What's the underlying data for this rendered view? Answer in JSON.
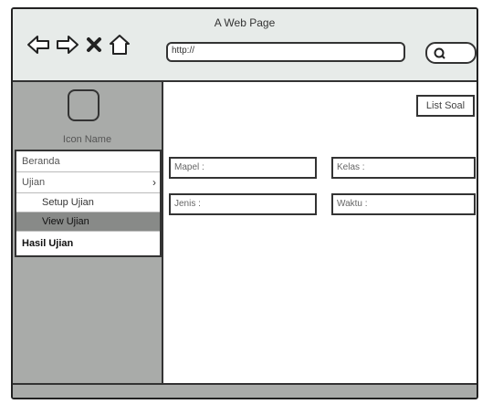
{
  "window": {
    "title": "A Web Page"
  },
  "browser": {
    "url": "http://",
    "icons": [
      "back-arrow-icon",
      "forward-arrow-icon",
      "close-icon",
      "home-icon",
      "search-icon"
    ]
  },
  "sidebar": {
    "icon_name": "Icon Name",
    "menu": [
      {
        "label": "Beranda"
      },
      {
        "label": "Ujian",
        "chevron": "›"
      },
      {
        "label": "Setup Ujian"
      },
      {
        "label": "View Ujian"
      },
      {
        "label": "Hasil Ujian"
      }
    ]
  },
  "main": {
    "list_soal": "List Soal",
    "fields": {
      "mapel": "Mapel :",
      "kelas": "Kelas :",
      "jenis": "Jenis :",
      "waktu": "Waktu :"
    }
  },
  "colors": {
    "sidebar": "#a9aba9",
    "active_menu": "#888a88",
    "page_background": "#eef3f1"
  }
}
